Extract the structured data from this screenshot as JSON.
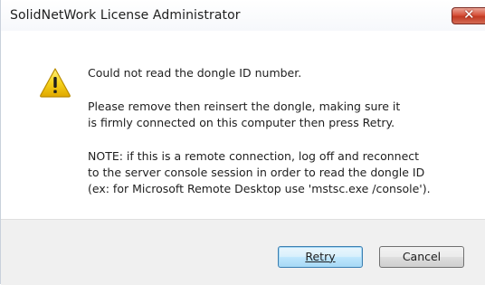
{
  "window": {
    "title": "SolidNetWork License Administrator",
    "close_label": "✕"
  },
  "message": {
    "icon": "warning-icon",
    "line1": "Could not read the dongle ID number.",
    "paragraph2": [
      "Please remove then reinsert the dongle, making sure it",
      "is firmly connected on this computer then press Retry."
    ],
    "paragraph3": [
      "NOTE: if this is a remote connection, log off and reconnect",
      "to the server console session in order to read the dongle ID",
      "(ex: for Microsoft Remote Desktop use 'mstsc.exe /console')."
    ]
  },
  "buttons": {
    "retry": "Retry",
    "cancel": "Cancel"
  },
  "colors": {
    "warning_fill": "#f5d21c",
    "close_red": "#c23a22",
    "footer_bg": "#f0f0f0"
  }
}
